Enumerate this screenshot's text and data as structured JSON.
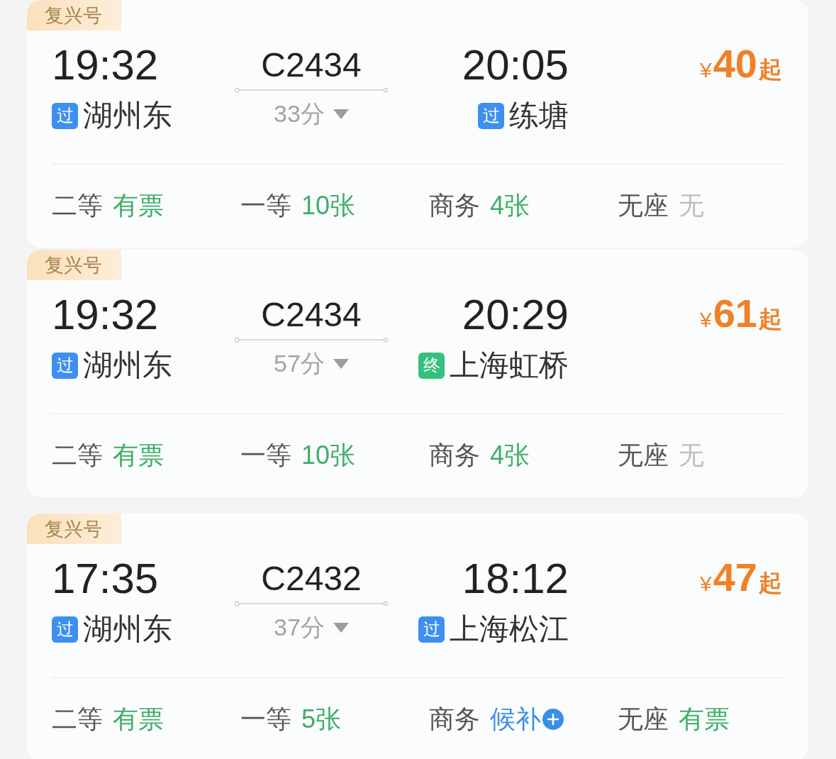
{
  "trains": [
    {
      "type_badge": "复兴号",
      "depart": {
        "time": "19:32",
        "station": "湖州东",
        "tag": {
          "text": "过",
          "kind": "pass"
        }
      },
      "train_no": "C2434",
      "duration": "33分",
      "arrive": {
        "time": "20:05",
        "station": "练塘",
        "tag": {
          "text": "过",
          "kind": "pass"
        }
      },
      "price": {
        "currency": "¥",
        "amount": "40",
        "suffix": "起"
      },
      "seats": [
        {
          "class": "二等",
          "availability": "有票",
          "kind": "available"
        },
        {
          "class": "一等",
          "availability": "10张",
          "kind": "available"
        },
        {
          "class": "商务",
          "availability": "4张",
          "kind": "available"
        },
        {
          "class": "无座",
          "availability": "无",
          "kind": "none"
        }
      ]
    },
    {
      "type_badge": "复兴号",
      "depart": {
        "time": "19:32",
        "station": "湖州东",
        "tag": {
          "text": "过",
          "kind": "pass"
        }
      },
      "train_no": "C2434",
      "duration": "57分",
      "arrive": {
        "time": "20:29",
        "station": "上海虹桥",
        "tag": {
          "text": "终",
          "kind": "terminal"
        }
      },
      "price": {
        "currency": "¥",
        "amount": "61",
        "suffix": "起"
      },
      "seats": [
        {
          "class": "二等",
          "availability": "有票",
          "kind": "available"
        },
        {
          "class": "一等",
          "availability": "10张",
          "kind": "available"
        },
        {
          "class": "商务",
          "availability": "4张",
          "kind": "available"
        },
        {
          "class": "无座",
          "availability": "无",
          "kind": "none"
        }
      ]
    },
    {
      "type_badge": "复兴号",
      "depart": {
        "time": "17:35",
        "station": "湖州东",
        "tag": {
          "text": "过",
          "kind": "pass"
        }
      },
      "train_no": "C2432",
      "duration": "37分",
      "arrive": {
        "time": "18:12",
        "station": "上海松江",
        "tag": {
          "text": "过",
          "kind": "pass"
        }
      },
      "price": {
        "currency": "¥",
        "amount": "47",
        "suffix": "起"
      },
      "seats": [
        {
          "class": "二等",
          "availability": "有票",
          "kind": "available"
        },
        {
          "class": "一等",
          "availability": "5张",
          "kind": "available"
        },
        {
          "class": "商务",
          "availability": "候补",
          "kind": "waitlist"
        },
        {
          "class": "无座",
          "availability": "有票",
          "kind": "available"
        }
      ]
    }
  ]
}
